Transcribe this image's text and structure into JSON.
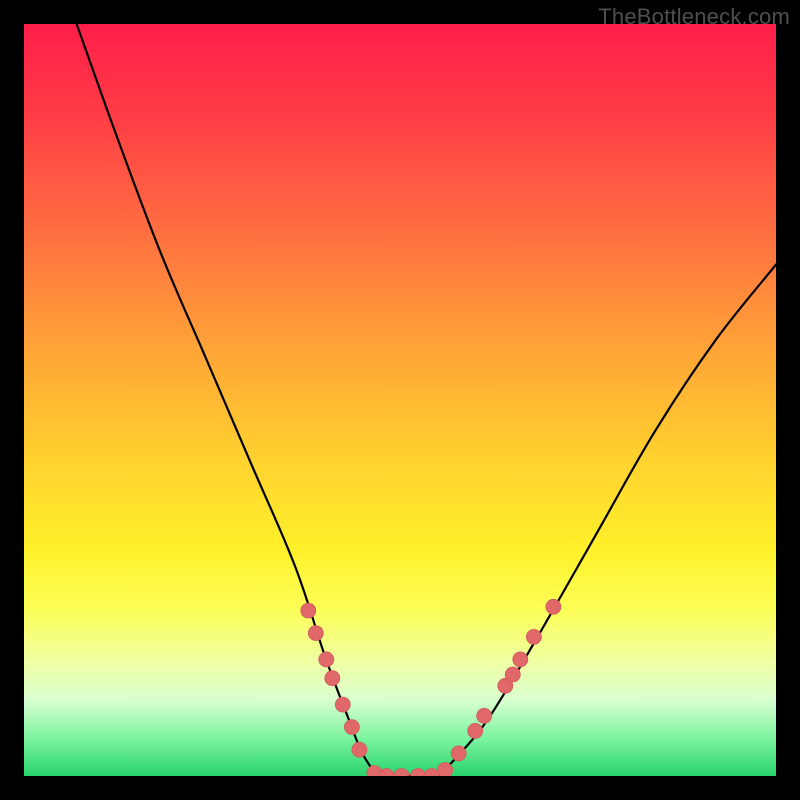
{
  "watermark": "TheBottleneck.com",
  "colors": {
    "frame": "#000000",
    "curve": "#000000",
    "marker_fill": "#e06868",
    "marker_stroke": "#cf5b5b"
  },
  "chart_data": {
    "type": "line",
    "title": "",
    "xlabel": "",
    "ylabel": "",
    "xlim": [
      0,
      100
    ],
    "ylim": [
      0,
      100
    ],
    "grid": false,
    "legend": false,
    "series": [
      {
        "name": "left-branch-curve",
        "x": [
          7,
          12,
          18,
          24,
          30,
          36,
          40,
          43,
          45,
          47
        ],
        "y": [
          100,
          86,
          70,
          56,
          42,
          28,
          16,
          8,
          3,
          0
        ]
      },
      {
        "name": "valley-floor",
        "x": [
          47,
          55
        ],
        "y": [
          0,
          0
        ]
      },
      {
        "name": "right-branch-curve",
        "x": [
          55,
          58,
          62,
          68,
          76,
          84,
          92,
          100
        ],
        "y": [
          0,
          3,
          8,
          18,
          32,
          46,
          58,
          68
        ]
      }
    ],
    "markers": [
      {
        "x": 37.8,
        "y": 22.0
      },
      {
        "x": 38.8,
        "y": 19.0
      },
      {
        "x": 40.2,
        "y": 15.5
      },
      {
        "x": 41.0,
        "y": 13.0
      },
      {
        "x": 42.4,
        "y": 9.5
      },
      {
        "x": 43.6,
        "y": 6.5
      },
      {
        "x": 44.6,
        "y": 3.5
      },
      {
        "x": 46.6,
        "y": 0.4
      },
      {
        "x": 48.2,
        "y": 0.0
      },
      {
        "x": 50.2,
        "y": 0.0
      },
      {
        "x": 52.4,
        "y": 0.0
      },
      {
        "x": 54.2,
        "y": 0.0
      },
      {
        "x": 56.0,
        "y": 0.8
      },
      {
        "x": 57.8,
        "y": 3.0
      },
      {
        "x": 60.0,
        "y": 6.0
      },
      {
        "x": 61.2,
        "y": 8.0
      },
      {
        "x": 64.0,
        "y": 12.0
      },
      {
        "x": 65.0,
        "y": 13.5
      },
      {
        "x": 66.0,
        "y": 15.5
      },
      {
        "x": 67.8,
        "y": 18.5
      },
      {
        "x": 70.4,
        "y": 22.5
      }
    ],
    "marker_radius_pct": 1.0
  }
}
